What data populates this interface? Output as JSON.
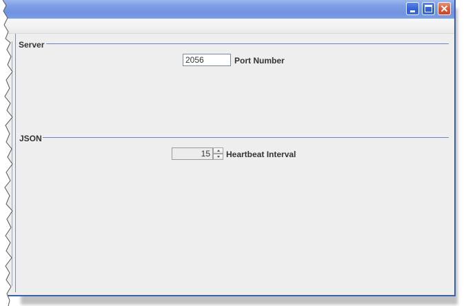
{
  "window": {
    "controls": {
      "minimize_icon": "minimize-icon",
      "maximize_icon": "maximize-icon",
      "close_icon": "close-icon"
    },
    "colors": {
      "titlebar": "#7e9fe6",
      "border": "#3a5fb5",
      "close_button": "#d9552f",
      "panel": "#eeeeee",
      "section_line": "#6b85c0"
    }
  },
  "server": {
    "title": "Server",
    "port_label": "Port Number",
    "port_value": "2056"
  },
  "json": {
    "title": "JSON",
    "heartbeat_label": "Heartbeat Interval",
    "heartbeat_value": "15"
  }
}
